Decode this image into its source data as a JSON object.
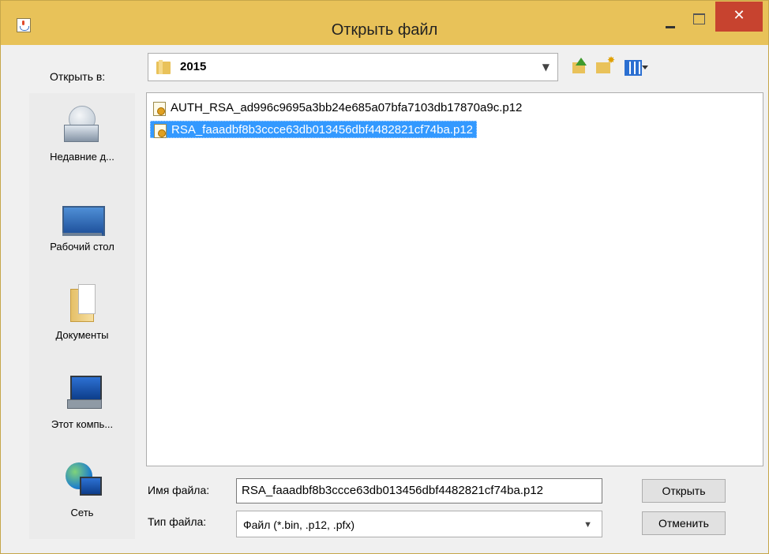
{
  "window": {
    "title": "Открыть файл",
    "close_label": "✕"
  },
  "lookin": {
    "label": "Открыть в:",
    "value": "2015"
  },
  "toolbar": {
    "icons": [
      "up-folder-icon",
      "new-folder-icon",
      "view-menu-icon"
    ]
  },
  "places": [
    {
      "label": "Недавние д...",
      "icon": "recent-items-icon"
    },
    {
      "label": "Рабочий стол",
      "icon": "desktop-icon"
    },
    {
      "label": "Документы",
      "icon": "documents-icon"
    },
    {
      "label": "Этот компь...",
      "icon": "computer-icon"
    },
    {
      "label": "Сеть",
      "icon": "network-icon"
    }
  ],
  "files": [
    {
      "name": "AUTH_RSA_ad996c9695a3bb24e685a07bfa7103db17870a9c.p12",
      "selected": false
    },
    {
      "name": "RSA_faaadbf8b3ccce63db013456dbf4482821cf74ba.p12",
      "selected": true
    }
  ],
  "filename": {
    "label": "Имя файла:",
    "value": "RSA_faaadbf8b3ccce63db013456dbf4482821cf74ba.p12"
  },
  "filetype": {
    "label": "Тип файла:",
    "value": "Файл (*.bin, .p12, .pfx)"
  },
  "buttons": {
    "open": "Открыть",
    "cancel": "Отменить"
  },
  "colors": {
    "titlebar": "#e8c259",
    "close_button": "#c7432f",
    "selection": "#3399ff"
  }
}
